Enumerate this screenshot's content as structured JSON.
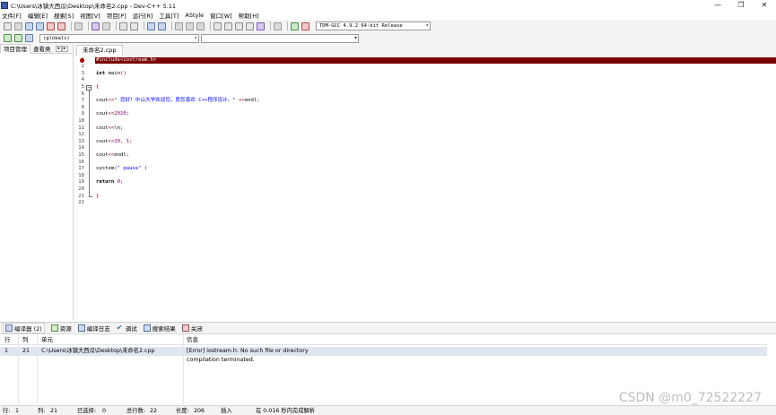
{
  "window": {
    "title": "C:\\Users\\冰镇大西瓜\\Desktop\\未命名2.cpp - Dev-C++ 5.11",
    "minimize": "—",
    "maximize": "❐",
    "close": "✕"
  },
  "menu": {
    "items": [
      "文件[F]",
      "编辑[E]",
      "搜索[S]",
      "视图[V]",
      "项目[P]",
      "运行[R]",
      "工具[T]",
      "AStyle",
      "窗口[W]",
      "帮助[H]"
    ]
  },
  "toolbar": {
    "compiler": "TDM-GCC 4.9.2 64-bit Release",
    "scope": "(globals)",
    "symbol": ""
  },
  "left_panel": {
    "tabs": [
      "项目管理",
      "查看类"
    ]
  },
  "editor": {
    "file_tab": "未命名2.cpp",
    "lines": [
      {
        "num": "1",
        "html": "<span>#include&lt;iostream.h&gt;</span>",
        "error": true
      },
      {
        "num": "2",
        "html": ""
      },
      {
        "num": "3",
        "html": "<span class=\"kw\">int</span> main<span class=\"sym\">()</span>"
      },
      {
        "num": "4",
        "html": ""
      },
      {
        "num": "5",
        "html": "<span class=\"sym\">{</span>"
      },
      {
        "num": "6",
        "html": ""
      },
      {
        "num": "7",
        "html": "cout<span class=\"sym\">&lt;&lt;</span><span class=\"str\">\" 您好！中山大学欢迎您，愿您喜欢 C++程序设计。\"</span> <span class=\"sym\">&lt;&lt;</span>endl<span class=\"sym\">;</span>"
      },
      {
        "num": "8",
        "html": ""
      },
      {
        "num": "9",
        "html": "cout<span class=\"sym\">&lt;&lt;</span><span class=\"num\">2020</span><span class=\"sym\">;</span>"
      },
      {
        "num": "10",
        "html": ""
      },
      {
        "num": "11",
        "html": "cout<span class=\"sym\">&lt;&lt;</span>\\n<span class=\"sym\">;</span>"
      },
      {
        "num": "12",
        "html": ""
      },
      {
        "num": "13",
        "html": "cout<span class=\"sym\">&lt;&lt;</span><span class=\"num\">20</span><span class=\"sym\">,</span> <span class=\"num\">1</span><span class=\"sym\">;</span>"
      },
      {
        "num": "14",
        "html": ""
      },
      {
        "num": "15",
        "html": "cout<span class=\"sym\">&lt;&lt;</span>endl<span class=\"sym\">;</span>"
      },
      {
        "num": "16",
        "html": ""
      },
      {
        "num": "17",
        "html": "system<span class=\"sym\">(</span><span class=\"str\">\" pause\"</span> <span class=\"sym\">)</span>"
      },
      {
        "num": "18",
        "html": ""
      },
      {
        "num": "19",
        "html": "<span class=\"kw\">return</span> <span class=\"num\">0</span><span class=\"sym\">;</span>"
      },
      {
        "num": "20",
        "html": ""
      },
      {
        "num": "21",
        "html": "<span class=\"sym\">}</span>"
      },
      {
        "num": "22",
        "html": ""
      }
    ]
  },
  "bottom_tabs": [
    {
      "label": "编译器 (2)",
      "icon": "grid-icon",
      "name": "tab-compiler"
    },
    {
      "label": "资源",
      "icon": "resources-icon",
      "name": "tab-resources"
    },
    {
      "label": "编译日志",
      "icon": "log-icon",
      "name": "tab-compile-log"
    },
    {
      "label": "调试",
      "icon": "check-icon",
      "name": "tab-debug"
    },
    {
      "label": "搜索结果",
      "icon": "search-results-icon",
      "name": "tab-search-results"
    },
    {
      "label": "关闭",
      "icon": "close-icon",
      "name": "tab-close"
    }
  ],
  "results": {
    "headers": {
      "row": "行",
      "col": "列",
      "unit": "单元",
      "info": "信息"
    },
    "rows": [
      {
        "row": "1",
        "col": "21",
        "unit": "C:\\Users\\冰镇大西瓜\\Desktop\\未命名2.cpp",
        "info": "[Error] iostream.h: No such file or directory"
      },
      {
        "row": "",
        "col": "",
        "unit": "",
        "info": "compilation terminated."
      }
    ]
  },
  "status": {
    "row_label": "行:",
    "row_value": "1",
    "col_label": "列:",
    "col_value": "21",
    "sel_label": "已选择:",
    "sel_value": "0",
    "total_label": "总行数:",
    "total_value": "22",
    "len_label": "长度:",
    "len_value": "206",
    "mode": "插入",
    "parse": "在 0.016 秒内完成解析"
  },
  "watermark": "CSDN @m0_72522227"
}
